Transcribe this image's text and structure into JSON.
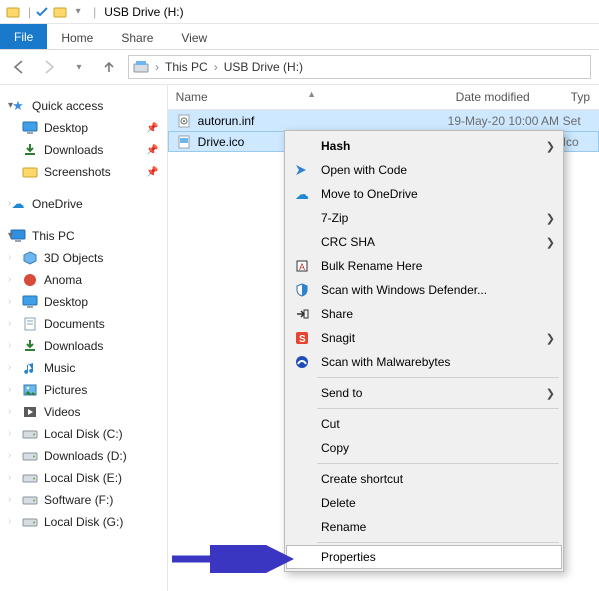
{
  "titlebar": {
    "app_title": "USB Drive (H:)"
  },
  "ribbon": {
    "file": "File",
    "home": "Home",
    "share": "Share",
    "view": "View"
  },
  "address": {
    "root": "This PC",
    "leaf": "USB Drive (H:)"
  },
  "columns": {
    "name": "Name",
    "date": "Date modified",
    "type": "Typ"
  },
  "files": [
    {
      "name": "autorun.inf",
      "date": "19-May-20 10:00 AM",
      "type": "Set",
      "icon": "settings-file-icon"
    },
    {
      "name": "Drive.ico",
      "date": "",
      "type": "Ico",
      "icon": "image-file-icon"
    }
  ],
  "sidebar": {
    "quick_access": "Quick access",
    "items_qa": [
      {
        "label": "Desktop",
        "icon": "desktop-icon",
        "pinned": true
      },
      {
        "label": "Downloads",
        "icon": "download-icon",
        "pinned": true
      },
      {
        "label": "Screenshots",
        "icon": "folder-icon",
        "pinned": true
      }
    ],
    "onedrive": "OneDrive",
    "this_pc": "This PC",
    "items_pc": [
      {
        "label": "3D Objects",
        "icon": "cube-icon"
      },
      {
        "label": "Anoma",
        "icon": "anoma-icon"
      },
      {
        "label": "Desktop",
        "icon": "desktop-icon"
      },
      {
        "label": "Documents",
        "icon": "documents-icon"
      },
      {
        "label": "Downloads",
        "icon": "download-icon"
      },
      {
        "label": "Music",
        "icon": "music-icon"
      },
      {
        "label": "Pictures",
        "icon": "pictures-icon"
      },
      {
        "label": "Videos",
        "icon": "videos-icon"
      },
      {
        "label": "Local Disk (C:)",
        "icon": "drive-icon"
      },
      {
        "label": "Downloads  (D:)",
        "icon": "drive-icon"
      },
      {
        "label": "Local Disk (E:)",
        "icon": "drive-icon"
      },
      {
        "label": "Software (F:)",
        "icon": "drive-icon"
      },
      {
        "label": "Local Disk (G:)",
        "icon": "drive-icon"
      }
    ]
  },
  "context_menu": {
    "items": [
      {
        "label": "Hash",
        "icon": "",
        "submenu": true,
        "bold": true
      },
      {
        "label": "Open with Code",
        "icon": "vscode-icon"
      },
      {
        "label": "Move to OneDrive",
        "icon": "onedrive-icon"
      },
      {
        "label": "7-Zip",
        "icon": "",
        "submenu": true
      },
      {
        "label": "CRC SHA",
        "icon": "",
        "submenu": true
      },
      {
        "label": "Bulk Rename Here",
        "icon": "rename-icon"
      },
      {
        "label": "Scan with Windows Defender...",
        "icon": "shield-icon"
      },
      {
        "label": "Share",
        "icon": "share-icon"
      },
      {
        "label": "Snagit",
        "icon": "snagit-icon",
        "submenu": true
      },
      {
        "label": "Scan with Malwarebytes",
        "icon": "malwarebytes-icon"
      },
      {
        "sep": true
      },
      {
        "label": "Send to",
        "icon": "",
        "submenu": true
      },
      {
        "sep": true
      },
      {
        "label": "Cut",
        "icon": ""
      },
      {
        "label": "Copy",
        "icon": ""
      },
      {
        "sep": true
      },
      {
        "label": "Create shortcut",
        "icon": ""
      },
      {
        "label": "Delete",
        "icon": ""
      },
      {
        "label": "Rename",
        "icon": ""
      },
      {
        "sep": true
      },
      {
        "label": "Properties",
        "icon": "",
        "highlight": true
      }
    ]
  },
  "colors": {
    "selection": "#cde8ff",
    "accent": "#1979ca",
    "arrow": "#3a36c2"
  }
}
